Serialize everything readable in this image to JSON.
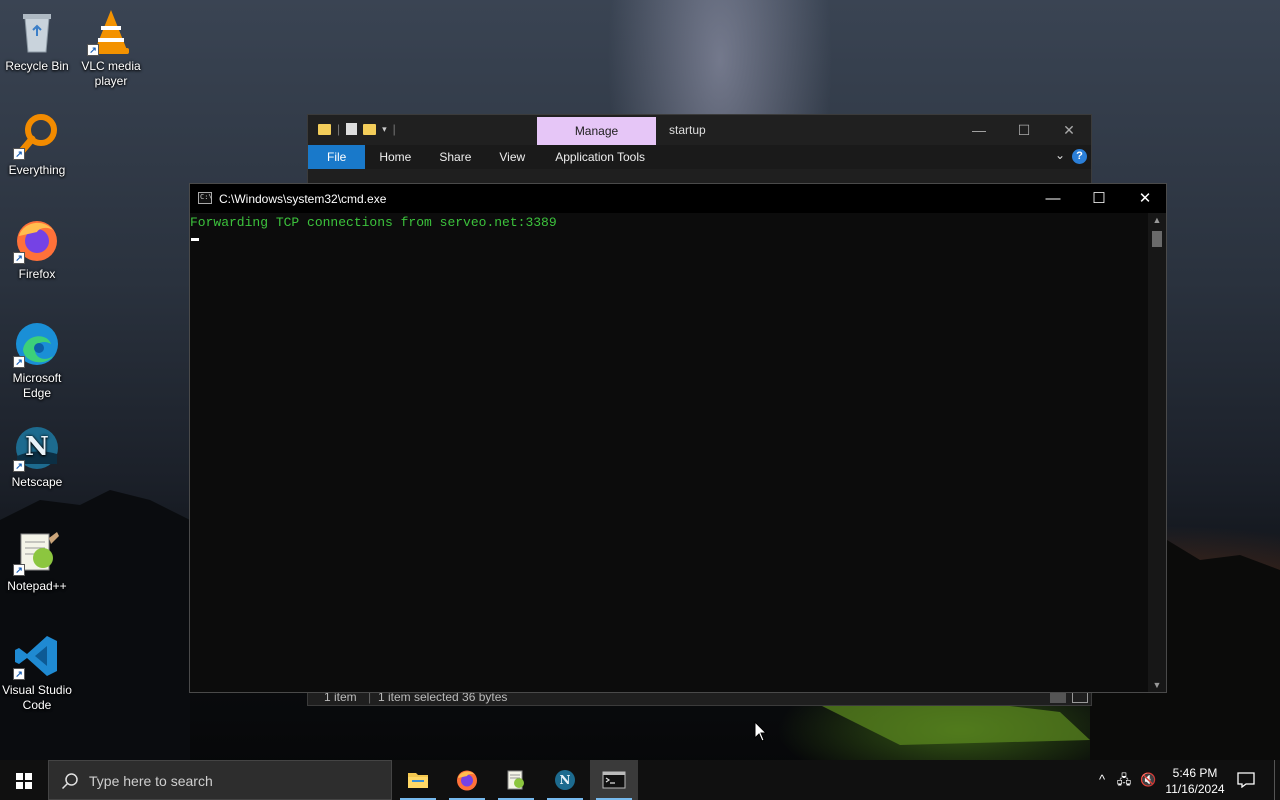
{
  "desktop": {
    "icons": [
      {
        "label": "Recycle Bin",
        "icon": "recycle-bin-icon"
      },
      {
        "label": "VLC media player",
        "icon": "vlc-icon"
      },
      {
        "label": "Everything",
        "icon": "everything-search-icon"
      },
      {
        "label": "Firefox",
        "icon": "firefox-icon"
      },
      {
        "label": "Microsoft Edge",
        "icon": "edge-icon"
      },
      {
        "label": "Netscape",
        "icon": "netscape-icon"
      },
      {
        "label": "Notepad++",
        "icon": "notepad-plus-plus-icon"
      },
      {
        "label": "Visual Studio Code",
        "icon": "vscode-icon"
      }
    ]
  },
  "explorer": {
    "context_tab": "Manage",
    "title": "startup",
    "ribbon_tabs": [
      "File",
      "Home",
      "Share",
      "View",
      "Application Tools"
    ],
    "status": {
      "items": "1 item",
      "selected": "1 item selected  36 bytes"
    },
    "colors": {
      "manage_bg": "#e6c6f7",
      "file_tab": "#1979ca"
    }
  },
  "cmd": {
    "title": "C:\\Windows\\system32\\cmd.exe",
    "output_line": "Forwarding TCP connections from serveo.net:3389",
    "colors": {
      "output": "#3cc23c",
      "background": "#0c0c0c"
    }
  },
  "taskbar": {
    "search_placeholder": "Type here to search",
    "apps": [
      {
        "name": "File Explorer",
        "icon": "file-explorer-icon",
        "active": false
      },
      {
        "name": "Firefox",
        "icon": "firefox-icon",
        "active": false
      },
      {
        "name": "Notepad++",
        "icon": "notepad-plus-plus-icon",
        "active": false
      },
      {
        "name": "Netscape",
        "icon": "netscape-icon",
        "active": false
      },
      {
        "name": "Command Prompt",
        "icon": "cmd-icon",
        "active": true
      }
    ],
    "time": "5:46 PM",
    "date": "11/16/2024"
  }
}
